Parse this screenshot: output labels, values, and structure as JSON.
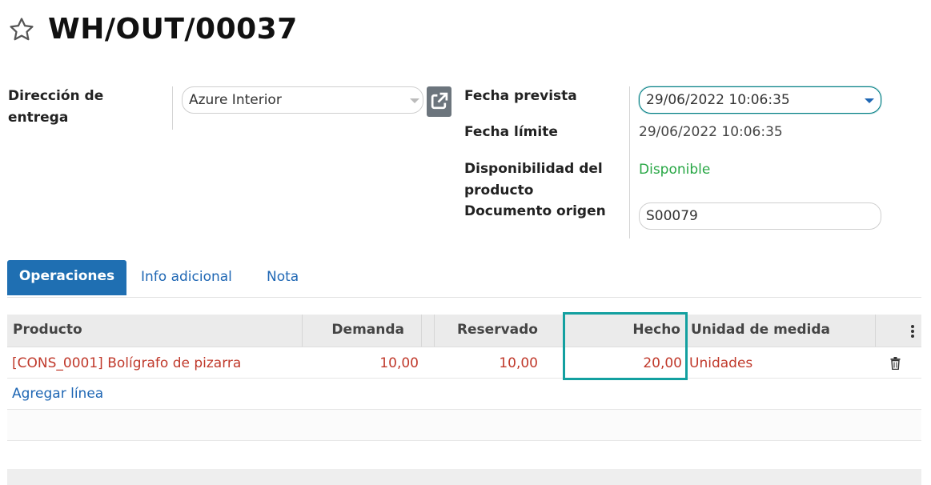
{
  "header": {
    "title": "WH/OUT/00037",
    "favorite_icon": "star-icon"
  },
  "form": {
    "delivery_address_label": "Dirección de entrega",
    "delivery_address_value": "Azure Interior",
    "scheduled_date_label": "Fecha prevista",
    "scheduled_date_value": "29/06/2022 10:06:35",
    "deadline_label": "Fecha límite",
    "deadline_value": "29/06/2022 10:06:35",
    "availability_label": "Disponibilidad del producto",
    "availability_value": "Disponible",
    "origin_label": "Documento origen",
    "origin_value": "S00079"
  },
  "tabs": [
    {
      "label": "Operaciones",
      "active": true
    },
    {
      "label": "Info adicional",
      "active": false
    },
    {
      "label": "Nota",
      "active": false
    }
  ],
  "table": {
    "headers": {
      "product": "Producto",
      "demand": "Demanda",
      "reserved": "Reservado",
      "done": "Hecho",
      "uom": "Unidad de medida"
    },
    "rows": [
      {
        "product": "[CONS_0001] Bolígrafo de pizarra",
        "demand": "10,00",
        "reserved": "10,00",
        "done": "20,00",
        "uom": "Unidades"
      }
    ],
    "add_line": "Agregar línea"
  },
  "colors": {
    "accent": "#1f6fb2",
    "link": "#1f67b4",
    "row_text": "#c0392b",
    "available": "#28a745",
    "highlight": "#13a0a0"
  }
}
